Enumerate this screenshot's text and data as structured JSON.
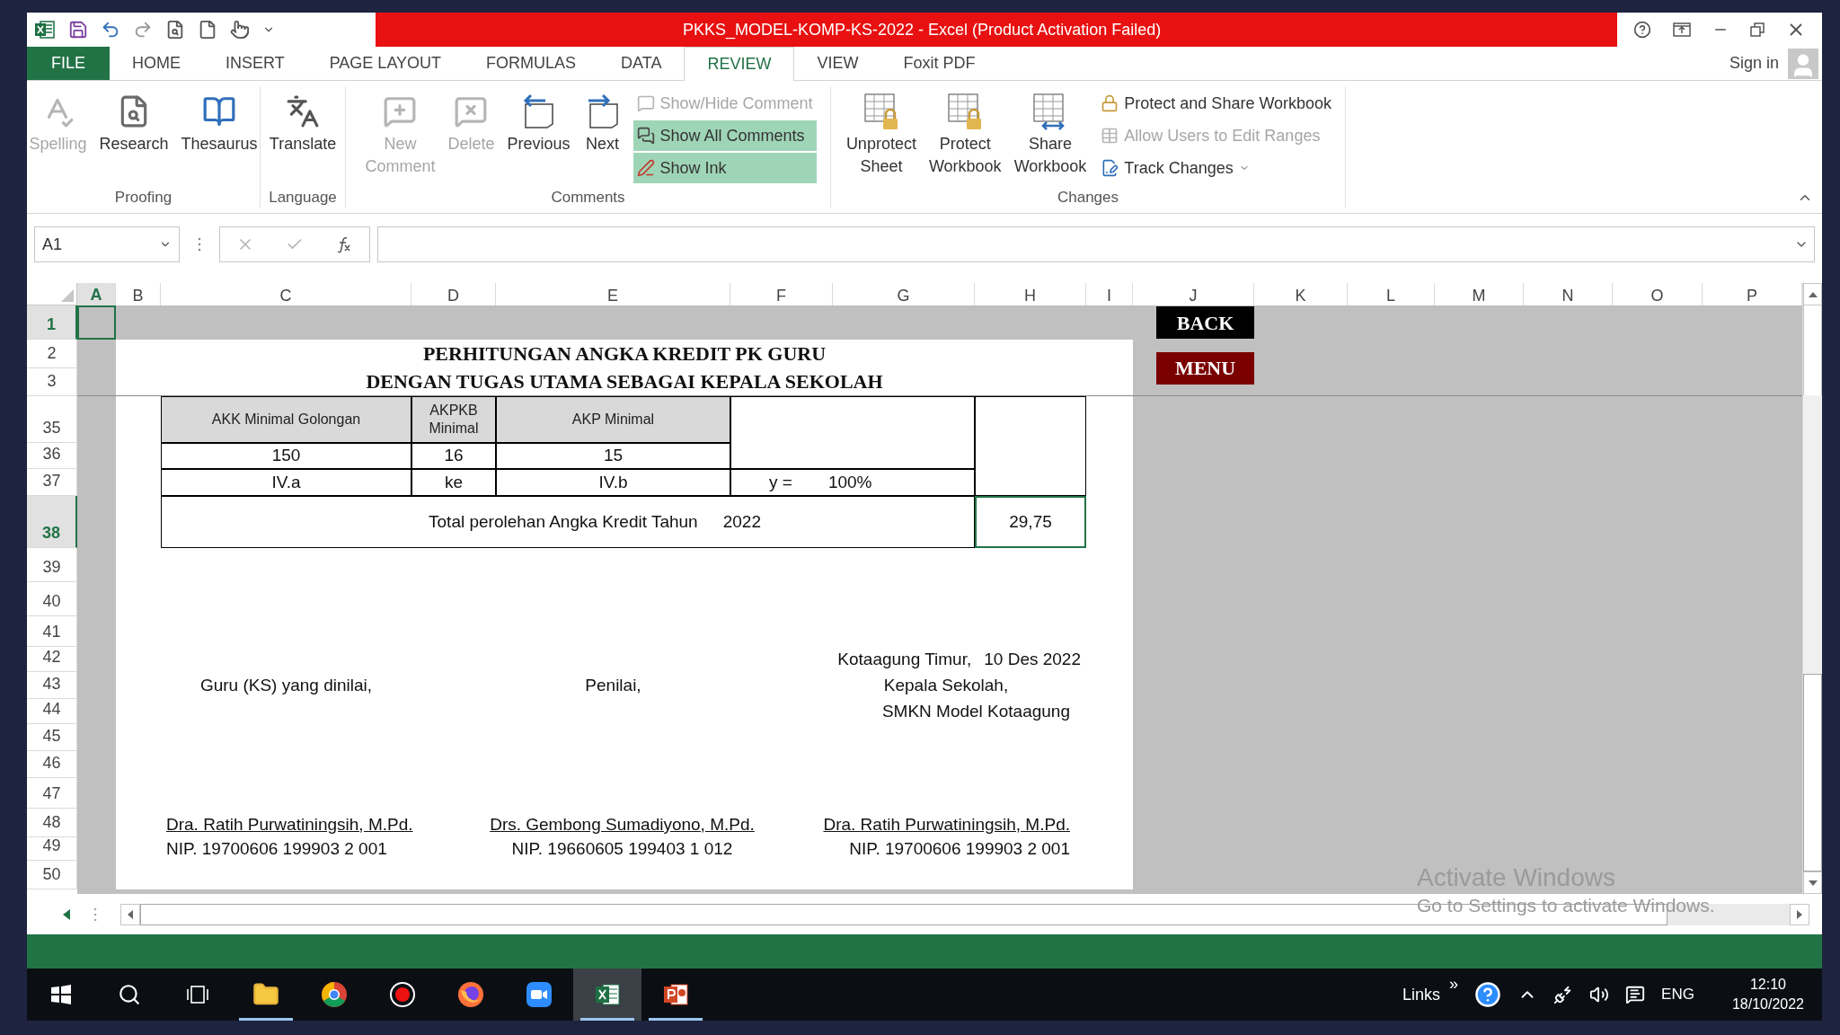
{
  "title_bar": {
    "title": "PKKS_MODEL-KOMP-KS-2022 -  Excel (Product Activation Failed)"
  },
  "tabs": [
    {
      "label": "FILE",
      "kind": "file",
      "selected": false
    },
    {
      "label": "HOME",
      "kind": "tab",
      "selected": false
    },
    {
      "label": "INSERT",
      "kind": "tab",
      "selected": false
    },
    {
      "label": "PAGE LAYOUT",
      "kind": "tab",
      "selected": false
    },
    {
      "label": "FORMULAS",
      "kind": "tab",
      "selected": false
    },
    {
      "label": "DATA",
      "kind": "tab",
      "selected": false
    },
    {
      "label": "REVIEW",
      "kind": "tab",
      "selected": true
    },
    {
      "label": "VIEW",
      "kind": "tab",
      "selected": false
    },
    {
      "label": "Foxit PDF",
      "kind": "tab",
      "selected": false
    }
  ],
  "account": {
    "label": "Sign in"
  },
  "ribbon": {
    "groups": [
      {
        "label": "Proofing",
        "buttons": [
          {
            "label": "Spelling",
            "kind": "large",
            "disabled": true
          },
          {
            "label": "Research",
            "kind": "large",
            "disabled": false
          },
          {
            "label": "Thesaurus",
            "kind": "large",
            "disabled": false
          }
        ]
      },
      {
        "label": "Language",
        "buttons": [
          {
            "label": "Translate",
            "kind": "large",
            "disabled": false
          }
        ]
      },
      {
        "label": "Comments",
        "buttons": [
          {
            "label": "New Comment",
            "kind": "large",
            "disabled": true
          },
          {
            "label": "Delete",
            "kind": "large",
            "disabled": true
          },
          {
            "label": "Previous",
            "kind": "large",
            "disabled": false
          },
          {
            "label": "Next",
            "kind": "large",
            "disabled": false
          },
          {
            "label": "Show/Hide Comment",
            "kind": "small",
            "disabled": true,
            "on": false
          },
          {
            "label": "Show All Comments",
            "kind": "small",
            "disabled": false,
            "on": true
          },
          {
            "label": "Show Ink",
            "kind": "small",
            "disabled": false,
            "on": true
          }
        ]
      },
      {
        "label": "Changes",
        "buttons": [
          {
            "label": "Unprotect Sheet",
            "kind": "large",
            "disabled": false
          },
          {
            "label": "Protect Workbook",
            "kind": "large",
            "disabled": false
          },
          {
            "label": "Share Workbook",
            "kind": "large",
            "disabled": false
          },
          {
            "label": "Protect and Share Workbook",
            "kind": "small",
            "disabled": false,
            "on": false
          },
          {
            "label": "Allow Users to Edit Ranges",
            "kind": "small",
            "disabled": true,
            "on": false
          },
          {
            "label": "Track Changes",
            "kind": "small_dropdown",
            "disabled": false,
            "on": false
          }
        ]
      }
    ]
  },
  "formula_bar": {
    "name_box": "A1"
  },
  "sheet": {
    "columns": [
      {
        "label": "A",
        "selected": true
      },
      {
        "label": "B",
        "selected": false
      },
      {
        "label": "C",
        "selected": false
      },
      {
        "label": "D",
        "selected": false
      },
      {
        "label": "E",
        "selected": false
      },
      {
        "label": "F",
        "selected": false
      },
      {
        "label": "G",
        "selected": false
      },
      {
        "label": "H",
        "selected": false
      },
      {
        "label": "I",
        "selected": false
      },
      {
        "label": "J",
        "selected": false
      },
      {
        "label": "K",
        "selected": false
      },
      {
        "label": "L",
        "selected": false
      },
      {
        "label": "M",
        "selected": false
      },
      {
        "label": "N",
        "selected": false
      },
      {
        "label": "O",
        "selected": false
      },
      {
        "label": "P",
        "selected": false
      }
    ],
    "rows": [
      {
        "label": "1",
        "selected": true
      },
      {
        "label": "2",
        "selected": false
      },
      {
        "label": "3",
        "selected": false
      },
      {
        "label": "35",
        "selected": false
      },
      {
        "label": "36",
        "selected": false
      },
      {
        "label": "37",
        "selected": false
      },
      {
        "label": "38",
        "selected": true
      },
      {
        "label": "39",
        "selected": false
      },
      {
        "label": "40",
        "selected": false
      },
      {
        "label": "41",
        "selected": false
      },
      {
        "label": "42",
        "selected": false
      },
      {
        "label": "43",
        "selected": false
      },
      {
        "label": "44",
        "selected": false
      },
      {
        "label": "45",
        "selected": false
      },
      {
        "label": "46",
        "selected": false
      },
      {
        "label": "47",
        "selected": false
      },
      {
        "label": "48",
        "selected": false
      },
      {
        "label": "49",
        "selected": false
      },
      {
        "label": "50",
        "selected": false
      }
    ],
    "sheet_buttons": [
      {
        "label": "BACK",
        "color": "#000000"
      },
      {
        "label": "MENU",
        "color": "#7a0000"
      }
    ]
  },
  "report": {
    "title_lines": [
      "PERHITUNGAN ANGKA KREDIT PK GURU",
      "DENGAN TUGAS UTAMA SEBAGAI KEPALA SEKOLAH"
    ],
    "table": {
      "header": [
        "AKK Minimal Golongan",
        "AKPKB Minimal",
        "AKP Minimal"
      ],
      "values": [
        "150",
        "16",
        "15"
      ],
      "grades": [
        "IV.a",
        "ke",
        "IV.b"
      ],
      "y_label": "y =",
      "y_value": "100%",
      "total_label": "Total perolehan Angka Kredit Tahun",
      "total_year": "2022",
      "total_value": "29,75"
    },
    "place": "Kotaagung Timur,",
    "date": "10 Des 2022",
    "signatories": [
      {
        "role": "Guru (KS) yang dinilai,",
        "name": "Dra. Ratih Purwatiningsih, M.Pd.",
        "nip": "NIP. 19700606 199903 2 001"
      },
      {
        "role": "Penilai,",
        "name": "Drs. Gembong Sumadiyono, M.Pd.",
        "nip": "NIP. 19660605 199403 1 012"
      },
      {
        "role": "Kepala Sekolah,",
        "organization": "SMKN Model Kotaagung",
        "name": "Dra. Ratih Purwatiningsih, M.Pd.",
        "nip": "NIP. 19700606 199903 2 001"
      }
    ]
  },
  "activation_notice": {
    "title": "Activate Windows",
    "subtitle": "Go to Settings to activate Windows."
  },
  "taskbar": {
    "buttons": [
      {
        "kind": "start"
      },
      {
        "kind": "search"
      },
      {
        "kind": "task_view"
      }
    ],
    "apps": [
      {
        "kind": "explorer",
        "running": true,
        "active": false
      },
      {
        "kind": "chrome",
        "running": false,
        "active": false
      },
      {
        "kind": "recorder",
        "running": false,
        "active": false
      },
      {
        "kind": "firefox",
        "running": false,
        "active": false
      },
      {
        "kind": "zoom",
        "running": false,
        "active": false
      },
      {
        "kind": "excel",
        "running": true,
        "active": true
      },
      {
        "kind": "powerpoint",
        "running": true,
        "active": false
      }
    ],
    "tray": {
      "links": "Links",
      "more": "»",
      "language": "ENG",
      "time": "12:10",
      "date": "18/10/2022"
    }
  }
}
